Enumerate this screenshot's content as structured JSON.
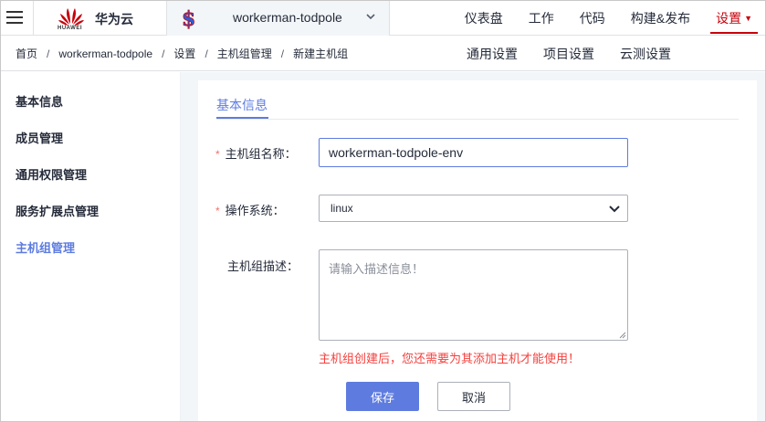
{
  "header": {
    "brand": "华为云",
    "logo_text": "HUAWEI",
    "project_name": "workerman-todpole",
    "nav": [
      {
        "label": "仪表盘"
      },
      {
        "label": "工作"
      },
      {
        "label": "代码"
      },
      {
        "label": "构建&发布"
      },
      {
        "label": "设置",
        "active": true
      }
    ]
  },
  "breadcrumb": [
    "首页",
    "workerman-todpole",
    "设置",
    "主机组管理",
    "新建主机组"
  ],
  "subnav": [
    "通用设置",
    "项目设置",
    "云测设置"
  ],
  "sidebar": {
    "items": [
      {
        "label": "基本信息"
      },
      {
        "label": "成员管理"
      },
      {
        "label": "通用权限管理"
      },
      {
        "label": "服务扩展点管理"
      },
      {
        "label": "主机组管理",
        "active": true
      }
    ]
  },
  "form": {
    "tab_label": "基本信息",
    "name_label": "主机组名称：",
    "name_value": "workerman-todpole-env",
    "os_label": "操作系统：",
    "os_value": "linux",
    "desc_label": "主机组描述：",
    "desc_placeholder": "请输入描述信息！",
    "hint": "主机组创建后，您还需要为其添加主机才能使用！",
    "required_mark": "*",
    "save_label": "保存",
    "cancel_label": "取消"
  },
  "colors": {
    "accent": "#5e7ce0",
    "brand_red": "#c7000b",
    "error": "#f4413e"
  }
}
